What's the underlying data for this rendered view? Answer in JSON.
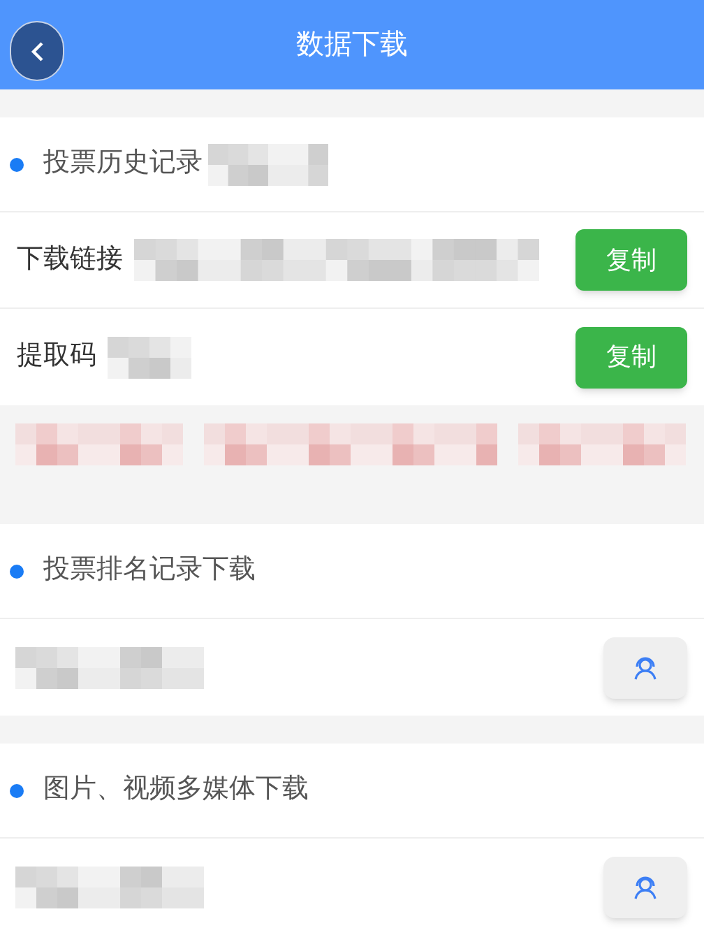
{
  "header": {
    "title": "数据下载"
  },
  "sections": [
    {
      "title": "投票历史记录",
      "rows": [
        {
          "kind": "copy",
          "label": "下载链接",
          "button": "复制"
        },
        {
          "kind": "copy",
          "label": "提取码",
          "button": "复制"
        }
      ]
    },
    {
      "title": "投票排名记录下载",
      "rows": [
        {
          "kind": "service"
        }
      ]
    },
    {
      "title": "图片、视频多媒体下载",
      "rows": [
        {
          "kind": "service"
        }
      ]
    }
  ]
}
